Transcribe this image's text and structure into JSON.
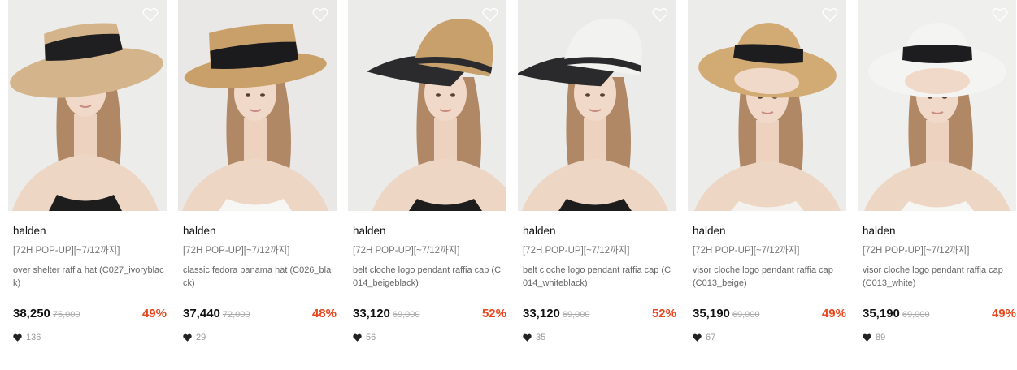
{
  "products": [
    {
      "brand": "halden",
      "promo": "[72H POP-UP][~7/12까지]",
      "name": "over shelter raffia hat (C027_ivoryblack)",
      "price": "38,250",
      "original_price": "75,000",
      "discount": "49%",
      "likes": "136",
      "hat_color": "#d4b48a",
      "band_color": "#1f1f22",
      "bg_color": "#ececea",
      "top_color": "#1d1d1d"
    },
    {
      "brand": "halden",
      "promo": "[72H POP-UP][~7/12까지]",
      "name": "classic fedora panama hat (C026_black)",
      "price": "37,440",
      "original_price": "72,000",
      "discount": "48%",
      "likes": "29",
      "hat_color": "#c9a06a",
      "band_color": "#1b1b1e",
      "bg_color": "#e9e8e6",
      "top_color": "#f6f6f4"
    },
    {
      "brand": "halden",
      "promo": "[72H POP-UP][~7/12까지]",
      "name": "belt cloche logo pendant raffia cap (C014_beigeblack)",
      "price": "33,120",
      "original_price": "69,000",
      "discount": "52%",
      "likes": "56",
      "hat_color": "#c8a06b",
      "band_color": "#2b2b2e",
      "bg_color": "#ebebea",
      "top_color": "#1d1d1d"
    },
    {
      "brand": "halden",
      "promo": "[72H POP-UP][~7/12까지]",
      "name": "belt cloche logo pendant raffia cap (C014_whiteblack)",
      "price": "33,120",
      "original_price": "69,000",
      "discount": "52%",
      "likes": "35",
      "hat_color": "#f2f2f0",
      "band_color": "#2a2a2d",
      "bg_color": "#ebebea",
      "top_color": "#1d1d1d"
    },
    {
      "brand": "halden",
      "promo": "[72H POP-UP][~7/12까지]",
      "name": "visor cloche logo pendant raffia cap (C013_beige)",
      "price": "35,190",
      "original_price": "69,000",
      "discount": "49%",
      "likes": "67",
      "hat_color": "#d2aa73",
      "band_color": "#1d1d20",
      "bg_color": "#ececea",
      "top_color": "#f4f2ee"
    },
    {
      "brand": "halden",
      "promo": "[72H POP-UP][~7/12까지]",
      "name": "visor cloche logo pendant raffia cap (C013_white)",
      "price": "35,190",
      "original_price": "69,000",
      "discount": "49%",
      "likes": "89",
      "hat_color": "#f4f4f2",
      "band_color": "#1d1d20",
      "bg_color": "#efefed",
      "top_color": "#f6f6f4"
    }
  ],
  "colors": {
    "discount": "#e8471e",
    "price": "#111111",
    "muted": "#aaaaaa"
  },
  "icons": {
    "wishlist": "heart-outline-icon",
    "likes": "heart-filled-icon"
  }
}
